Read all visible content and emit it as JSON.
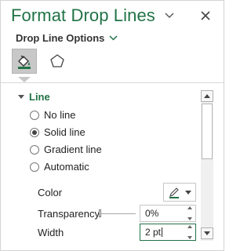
{
  "pane": {
    "title": "Format Drop Lines",
    "subtitle": "Drop Line Options",
    "accent_color": "#217346",
    "icons": {
      "dropdown": "chevron-down-icon",
      "close": "close-icon",
      "fill_line_tab": "paint-bucket-icon",
      "effects_tab": "pentagon-icon"
    }
  },
  "line_section": {
    "heading": "Line",
    "options": [
      {
        "label": "No line",
        "checked": false
      },
      {
        "label": "Solid line",
        "checked": true
      },
      {
        "label": "Gradient line",
        "checked": false
      },
      {
        "label": "Automatic",
        "checked": false
      }
    ],
    "color_label": "Color",
    "transparency_label": "Transparency",
    "transparency_value": "0%",
    "width_label": "Width",
    "width_value": "2 pt"
  }
}
